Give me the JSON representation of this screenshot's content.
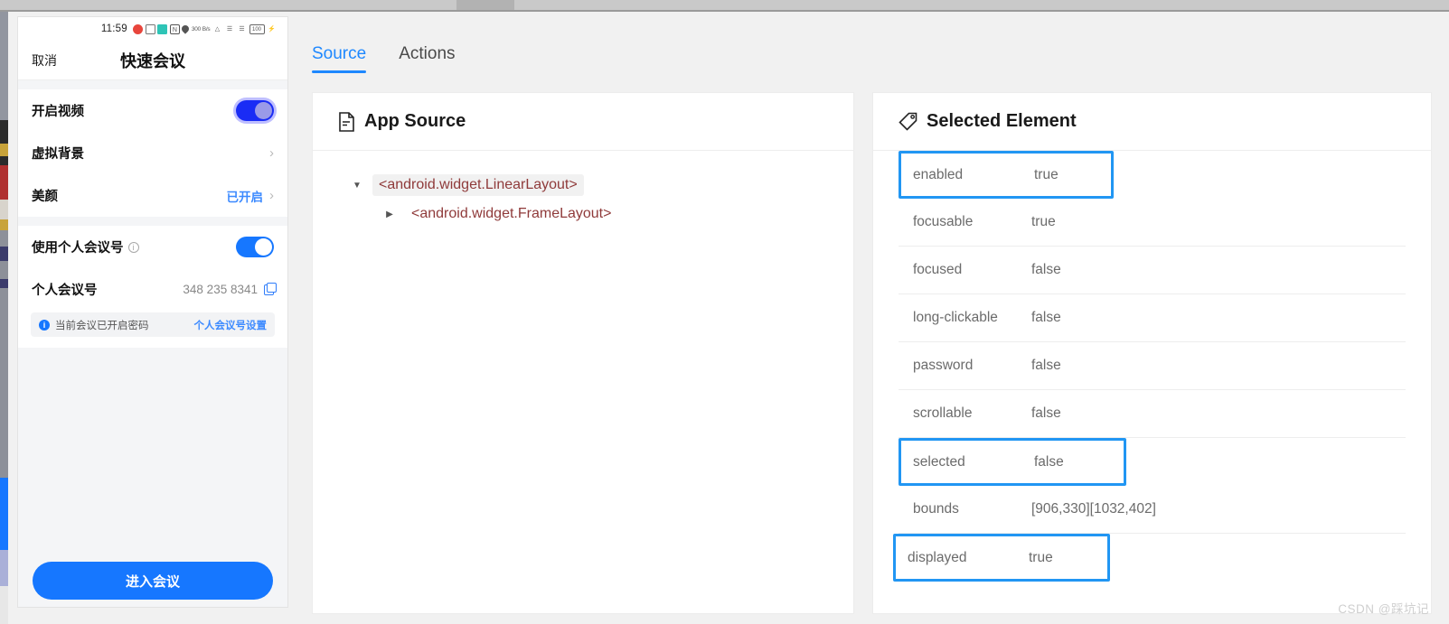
{
  "phone": {
    "status_bar": {
      "clock": "11:59",
      "icons": [
        "color-flower-icon",
        "grid-icon",
        "calendar-icon",
        "nfc-icon",
        "location-pin-icon",
        "data-rate-icon",
        "wifi-icon",
        "signal-1-icon",
        "signal-2-icon",
        "battery-icon",
        "charging-icon"
      ],
      "data_rate": "300 B/s",
      "battery_level": "100"
    },
    "nav": {
      "cancel_label": "取消",
      "title": "快速会议"
    },
    "rows": [
      {
        "label": "开启视频",
        "control": "toggle",
        "on": true,
        "focused": true
      },
      {
        "label": "虚拟背景",
        "control": "chevron",
        "value": ""
      },
      {
        "label": "美颜",
        "control": "chevron",
        "value": "已开启"
      },
      {
        "label": "使用个人会议号",
        "control": "toggle",
        "on": true,
        "focused": false,
        "has_info": true
      },
      {
        "label": "个人会议号",
        "control": "copy",
        "value": "348 235 8341"
      }
    ],
    "notice": {
      "icon": "info-icon",
      "text": "当前会议已开启密码",
      "link": "个人会议号设置"
    },
    "footer": {
      "enter_label": "进入会议"
    }
  },
  "tabs": [
    {
      "label": "Source",
      "active": true
    },
    {
      "label": "Actions",
      "active": false
    }
  ],
  "source_panel": {
    "icon": "document-icon",
    "title": "App Source",
    "tree": [
      {
        "label": "<android.widget.LinearLayout>",
        "level": 0,
        "expanded": true,
        "selected": true
      },
      {
        "label": "<android.widget.FrameLayout>",
        "level": 1,
        "expanded": false,
        "selected": false
      }
    ]
  },
  "element_panel": {
    "icon": "tag-icon",
    "title": "Selected Element",
    "properties": [
      {
        "key": "enabled",
        "value": "true",
        "highlight": true,
        "hl_class": "w1"
      },
      {
        "key": "focusable",
        "value": "true",
        "highlight": false,
        "hl_class": ""
      },
      {
        "key": "focused",
        "value": "false",
        "highlight": false,
        "hl_class": ""
      },
      {
        "key": "long-clickable",
        "value": "false",
        "highlight": false,
        "hl_class": ""
      },
      {
        "key": "password",
        "value": "false",
        "highlight": false,
        "hl_class": ""
      },
      {
        "key": "scrollable",
        "value": "false",
        "highlight": false,
        "hl_class": ""
      },
      {
        "key": "selected",
        "value": "false",
        "highlight": true,
        "hl_class": "w2"
      },
      {
        "key": "bounds",
        "value": "[906,330][1032,402]",
        "highlight": false,
        "hl_class": ""
      },
      {
        "key": "displayed",
        "value": "true",
        "highlight": true,
        "hl_class": "w3"
      }
    ]
  },
  "watermark": "CSDN @踩坑记",
  "colors": {
    "accent_blue": "#1677ff",
    "tab_blue": "#1e88ff",
    "highlight_blue": "#2196f3",
    "tree_text": "#8f3a3a",
    "page_bg": "#f1f1f1"
  }
}
